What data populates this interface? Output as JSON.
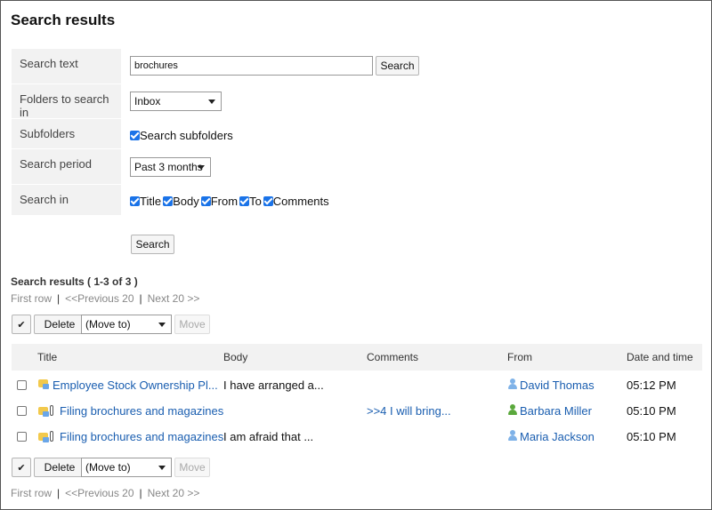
{
  "page": {
    "title": "Search results"
  },
  "form": {
    "search_text_label": "Search text",
    "search_text_value": "brochures",
    "search_button": "Search",
    "folders_label": "Folders to search in",
    "folder_selected": "Inbox",
    "subfolders_label": "Subfolders",
    "subfolders_option": "Search subfolders",
    "period_label": "Search period",
    "period_selected": "Past 3 months",
    "search_in_label": "Search in",
    "search_in_options": [
      "Title",
      "Body",
      "From",
      "To",
      "Comments"
    ],
    "submit_button": "Search"
  },
  "results": {
    "heading": "Search results ( 1-3 of 3 )",
    "pager": {
      "first": "First row",
      "prev": "<<Previous 20",
      "next": "Next 20 >>"
    },
    "actions": {
      "check_all": "✔",
      "delete": "Delete",
      "move_to": "(Move to)",
      "move": "Move"
    },
    "columns": {
      "title": "Title",
      "body": "Body",
      "comments": "Comments",
      "from": "From",
      "date": "Date and time"
    },
    "rows": [
      {
        "title": "Employee Stock Ownership Pl...",
        "has_attachment": false,
        "body": "I have arranged a...",
        "comments": "",
        "from": "David Thomas",
        "from_icon": "user-blue-icon",
        "date": "05:12 PM"
      },
      {
        "title": "Filing brochures and magazines",
        "has_attachment": true,
        "body": "",
        "comments": ">>4 I will bring...",
        "from": "Barbara Miller",
        "from_icon": "user-green-icon",
        "date": "05:10 PM"
      },
      {
        "title": "Filing brochures and magazines",
        "has_attachment": true,
        "body": "I am afraid that ...",
        "comments": "",
        "from": "Maria Jackson",
        "from_icon": "user-blue-icon",
        "date": "05:10 PM"
      }
    ]
  },
  "colors": {
    "link": "#1a5eb0",
    "checkbox": "#1a73e8",
    "label_bg": "#f2f2f2",
    "user_blue": "#7fb2e8",
    "user_green": "#5aa83c"
  }
}
